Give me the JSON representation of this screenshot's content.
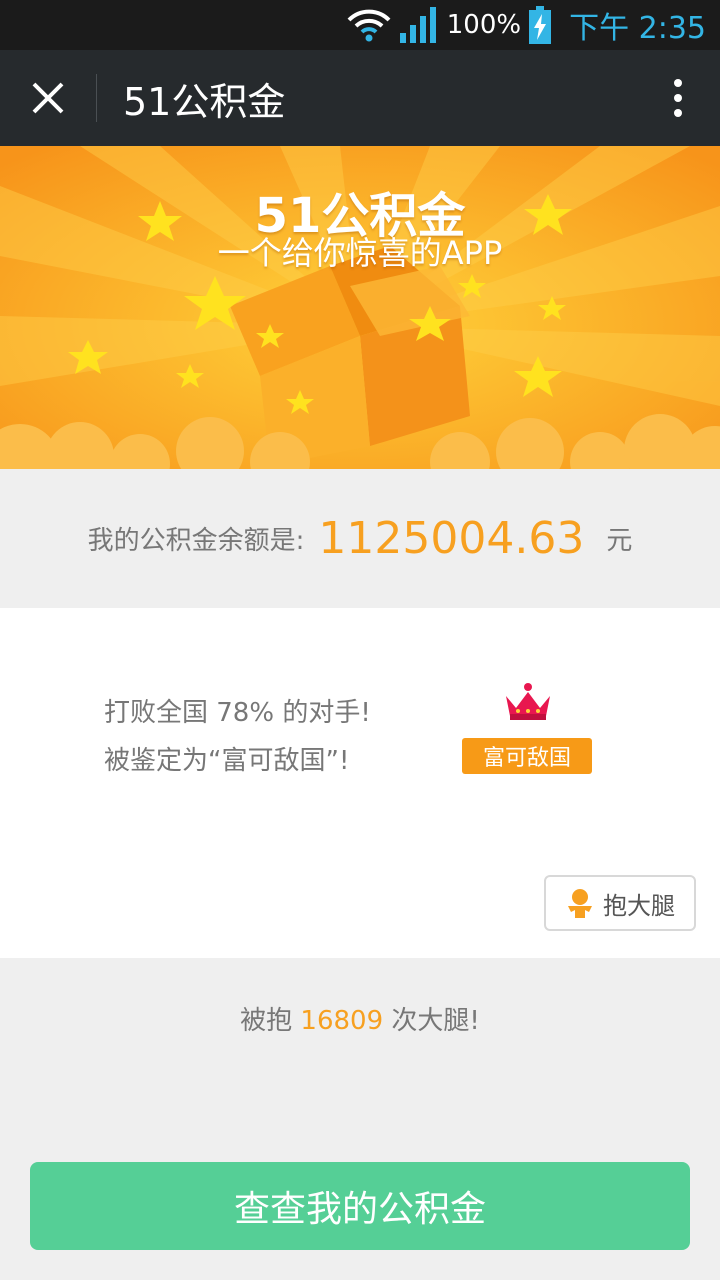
{
  "status_bar": {
    "battery_percent": "100%",
    "time": "下午 2:35",
    "icons": [
      "wifi-icon",
      "signal-icon",
      "battery-charging-icon"
    ]
  },
  "title_bar": {
    "title": "51公积金",
    "icons": [
      "close-icon",
      "more-vertical-icon"
    ]
  },
  "banner": {
    "title": "51公积金",
    "subtitle": "一个给你惊喜的APP",
    "icons": [
      "star-icon",
      "gift-box-icon",
      "cloud-icon"
    ]
  },
  "balance": {
    "label": "我的公积金余额是:",
    "amount": "1125004.63",
    "unit": "元"
  },
  "rank": {
    "line1": "打败全国 78% 的对手!",
    "line2": "被鉴定为“富可敌国”!",
    "badge": "富可敌国",
    "hug_button": "抱大腿",
    "icons": [
      "crown-icon",
      "person-icon"
    ]
  },
  "hug_count": {
    "prefix": "被抱",
    "count": "16809",
    "suffix": "次大腿!"
  },
  "cta": {
    "label": "查查我的公积金"
  },
  "colors": {
    "accent_orange": "#f7a020",
    "cta_green": "#55cf96",
    "titlebar_bg": "#262a2d",
    "statusbar_bg": "#1b1b1b"
  }
}
